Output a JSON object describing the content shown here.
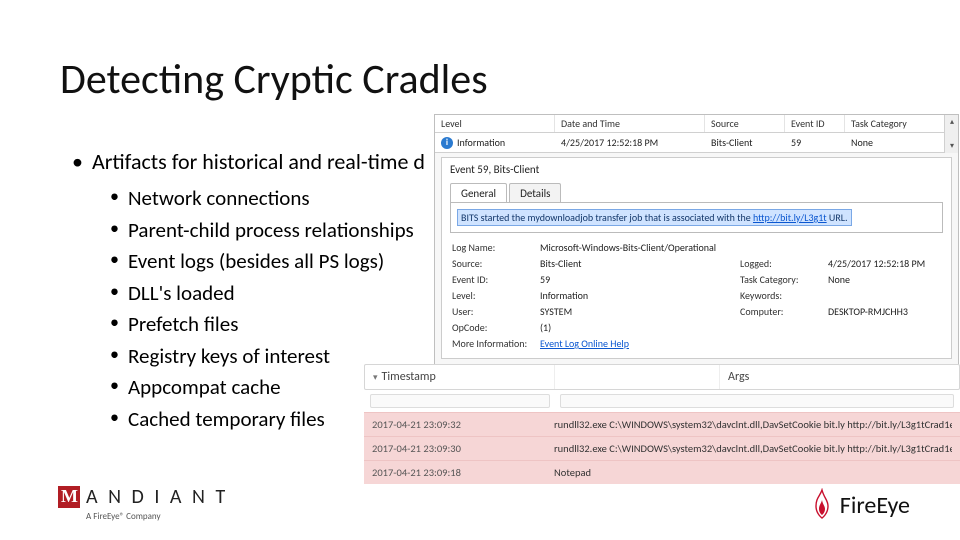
{
  "title": "Detecting Cryptic Cradles",
  "top_bullet": "Artifacts for historical and real-time d",
  "sub_bullets": [
    "Network connections",
    "Parent-child process relationships",
    "Event logs (besides all PS logs)",
    "DLL's loaded",
    "Prefetch files",
    "Registry keys of interest",
    "Appcompat cache",
    "Cached temporary files"
  ],
  "event_viewer": {
    "headers": {
      "level": "Level",
      "datetime": "Date and Time",
      "source": "Source",
      "eventid": "Event ID",
      "task": "Task Category"
    },
    "row": {
      "level": "Information",
      "datetime": "4/25/2017 12:52:18 PM",
      "source": "Bits-Client",
      "eventid": "59",
      "task": "None"
    },
    "event_title": "Event 59, Bits-Client",
    "tabs": {
      "general": "General",
      "details": "Details"
    },
    "message_pre": "BITS started the mydownloadjob transfer job that is associated with the ",
    "message_link": "http://bit.ly/L3g1t",
    "message_post": " URL.",
    "grid": {
      "log_name_lbl": "Log Name:",
      "log_name": "Microsoft-Windows-Bits-Client/Operational",
      "source_lbl": "Source:",
      "source": "Bits-Client",
      "logged_lbl": "Logged:",
      "logged": "4/25/2017 12:52:18 PM",
      "eventid_lbl": "Event ID:",
      "eventid": "59",
      "task_lbl": "Task Category:",
      "task": "None",
      "level_lbl": "Level:",
      "level": "Information",
      "keywords_lbl": "Keywords:",
      "keywords": "",
      "user_lbl": "User:",
      "user": "SYSTEM",
      "computer_lbl": "Computer:",
      "computer": "DESKTOP-RMJCHH3",
      "opcode_lbl": "OpCode:",
      "opcode": "(1)",
      "more_lbl": "More Information:",
      "more": "Event Log Online Help"
    }
  },
  "forensic": {
    "headers": {
      "ts": "Timestamp",
      "args": "Args"
    },
    "rows": [
      {
        "ts": "2017-04-21 23:09:32",
        "args": "rundll32.exe C:\\WINDOWS\\system32\\davclnt.dll,DavSetCookie bit.ly http://bit.ly/L3g1tCrad1e"
      },
      {
        "ts": "2017-04-21 23:09:30",
        "args": "rundll32.exe C:\\WINDOWS\\system32\\davclnt.dll,DavSetCookie bit.ly http://bit.ly/L3g1tCrad1e"
      },
      {
        "ts": "2017-04-21 23:09:18",
        "args": "Notepad"
      }
    ]
  },
  "logos": {
    "mandiant": "A N D I A N T",
    "mandiant_sub": "A FireEye® Company",
    "fireeye": "FireEye"
  }
}
